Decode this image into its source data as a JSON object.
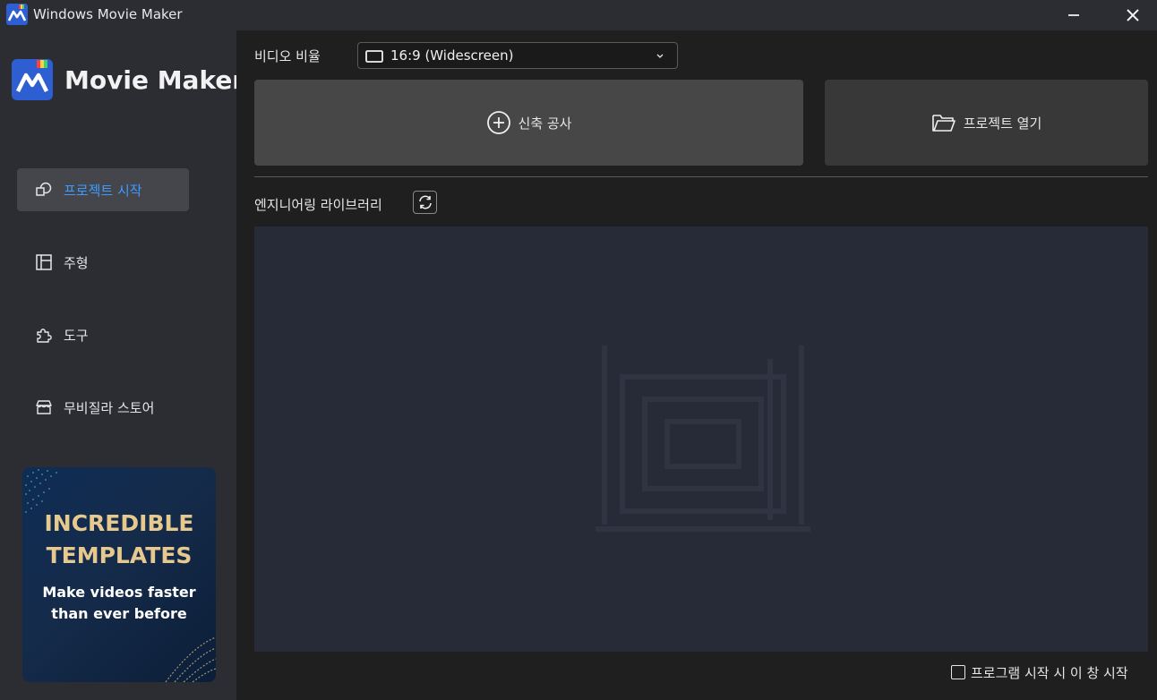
{
  "window": {
    "title": "Windows Movie Maker",
    "minimize_glyph": "—",
    "close_glyph": "✕"
  },
  "brand": {
    "name": "Movie Maker",
    "accent": "#3d9bff"
  },
  "sidebar": {
    "items": [
      {
        "label": "프로젝트 시작",
        "icon": "shapes-icon",
        "active": true
      },
      {
        "label": "주형",
        "icon": "template-icon",
        "active": false
      },
      {
        "label": "도구",
        "icon": "puzzle-icon",
        "active": false
      },
      {
        "label": "무비질라 스토어",
        "icon": "store-icon",
        "active": false
      }
    ],
    "promo": {
      "headline1": "INCREDIBLE",
      "headline2": "TEMPLATES",
      "sub1": "Make videos faster",
      "sub2": "than ever before"
    }
  },
  "main": {
    "ratio_label": "비디오 비율",
    "ratio_value": "16:9 (Widescreen)",
    "new_project_label": "신축 공사",
    "open_project_label": "프로젝트 열기",
    "library_label": "엔지니어링 라이브러리",
    "startup_checkbox_label": "프로그램 시작 시 이 창 시작",
    "startup_checked": false
  }
}
